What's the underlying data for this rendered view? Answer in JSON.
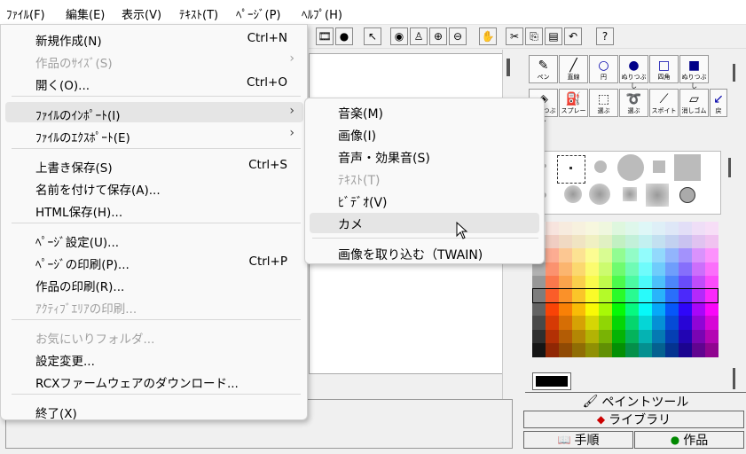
{
  "menubar": [
    {
      "label": "ﾌｧｲﾙ(F)",
      "id": "file"
    },
    {
      "label": "編集(E)",
      "id": "edit"
    },
    {
      "label": "表示(V)",
      "id": "view"
    },
    {
      "label": "ﾃｷｽﾄ(T)",
      "id": "text"
    },
    {
      "label": "ﾍﾟｰｼﾞ(P)",
      "id": "page"
    },
    {
      "label": "ﾍﾙﾌﾟ(H)",
      "id": "help"
    }
  ],
  "file_menu": {
    "items": [
      {
        "label": "新規作成(N)",
        "shortcut": "Ctrl+N"
      },
      {
        "label": "作品のｻｲｽﾞ(S)",
        "arrow": "›"
      },
      {
        "label": "開く(O)...",
        "shortcut": "Ctrl+O"
      },
      {
        "label": "ﾌｧｲﾙのｲﾝﾎﾟｰﾄ(I)",
        "arrow": "›"
      },
      {
        "label": "ﾌｧｲﾙのｴｸｽﾎﾟｰﾄ(E)",
        "arrow": "›"
      },
      {
        "label": "上書き保存(S)",
        "shortcut": "Ctrl+S"
      },
      {
        "label": "名前を付けて保存(A)..."
      },
      {
        "label": "HTML保存(H)..."
      },
      {
        "label": "ﾍﾟｰｼﾞ設定(U)..."
      },
      {
        "label": "ﾍﾟｰｼﾞの印刷(P)...",
        "shortcut": "Ctrl+P"
      },
      {
        "label": "作品の印刷(R)..."
      },
      {
        "label": "ｱｸﾃｨﾌﾞｴﾘｱの印刷..."
      },
      {
        "label": "お気にいりフォルダ..."
      },
      {
        "label": "設定変更..."
      },
      {
        "label": "RCXファームウェアのダウンロード..."
      },
      {
        "label": "終了(X)"
      }
    ]
  },
  "import_submenu": {
    "items": [
      {
        "label": "音楽(M)"
      },
      {
        "label": "画像(I)"
      },
      {
        "label": "音声・効果音(S)"
      },
      {
        "label": "ﾃｷｽﾄ(T)"
      },
      {
        "label": "ﾋﾞﾃﾞｵ(V)"
      },
      {
        "label": "カメ"
      },
      {
        "label": "画像を取り込む（TWAIN)"
      }
    ]
  },
  "toolbar": {
    "icons": [
      "film-icon",
      "globe-icon",
      "pointer-icon",
      "eye-icon",
      "stamp-icon",
      "zoom-in-icon",
      "zoom-out-icon",
      "stop-hand-icon",
      "scissors-icon",
      "copy-icon",
      "paste-icon",
      "undo-icon",
      "help-icon"
    ],
    "help_label": "?"
  },
  "tools": {
    "row1": [
      {
        "name": "pen",
        "label": "ペン"
      },
      {
        "name": "line",
        "label": "直線"
      },
      {
        "name": "circle",
        "label": "円"
      },
      {
        "name": "filled-circle",
        "label": "ぬりつぶし"
      },
      {
        "name": "rectangle",
        "label": "四角"
      },
      {
        "name": "filled-rectangle",
        "label": "ぬりつぶし"
      }
    ],
    "row2": [
      {
        "name": "fill",
        "label": "ぬりつぶし"
      },
      {
        "name": "spray",
        "label": "スプレー"
      },
      {
        "name": "select",
        "label": "選ぶ"
      },
      {
        "name": "lasso",
        "label": "選ぶ"
      },
      {
        "name": "dropper",
        "label": "スポイト"
      },
      {
        "name": "eraser",
        "label": "消しゴム"
      },
      {
        "name": "back",
        "label": "戻"
      }
    ]
  },
  "tabs": {
    "paint": "ペイントツール",
    "library": "ライブラリ",
    "steps": "手順",
    "works": "作品"
  },
  "colors": {
    "current": "#000000"
  }
}
